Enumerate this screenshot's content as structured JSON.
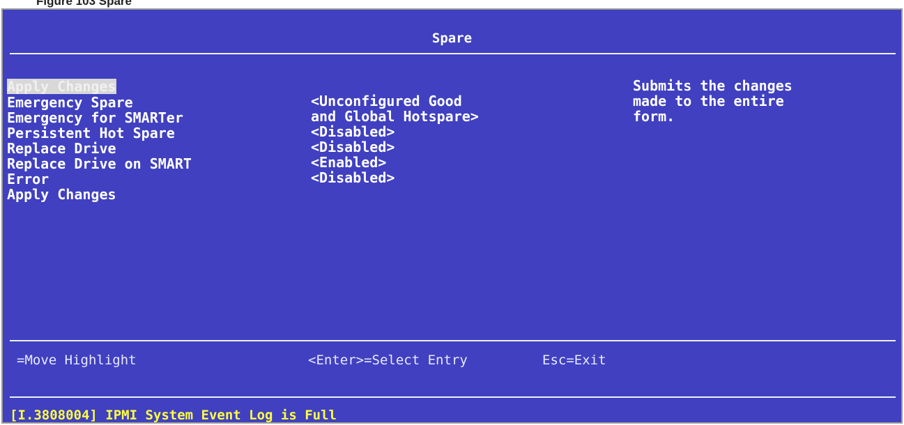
{
  "caption": "Figure 103 Spare",
  "title": "Spare",
  "menu": [
    {
      "label": "Apply Changes",
      "value": ""
    },
    {
      "label": "Emergency Spare",
      "value": "<Unconfigured Good"
    },
    {
      "label": "",
      "value": "and Global Hotspare>"
    },
    {
      "label": "Emergency for SMARTer",
      "value": "<Disabled>"
    },
    {
      "label": "Persistent Hot Spare",
      "value": "<Disabled>"
    },
    {
      "label": "Replace Drive",
      "value": "<Enabled>"
    },
    {
      "label": "Replace Drive on SMART",
      "value": "<Disabled>"
    },
    {
      "label": "Error",
      "value": ""
    },
    {
      "label": "Apply Changes",
      "value": ""
    }
  ],
  "help": "Submits the changes\nmade to the entire\nform.",
  "keys": {
    "move": "=Move Highlight",
    "select": "<Enter>=Select Entry",
    "exit": "Esc=Exit"
  },
  "status": "[I.3808004] IPMI System Event Log is Full",
  "colors": {
    "background": "#4040c0",
    "text": "#ffffff",
    "status": "#ffff40",
    "highlight": "#d8d8d8"
  }
}
